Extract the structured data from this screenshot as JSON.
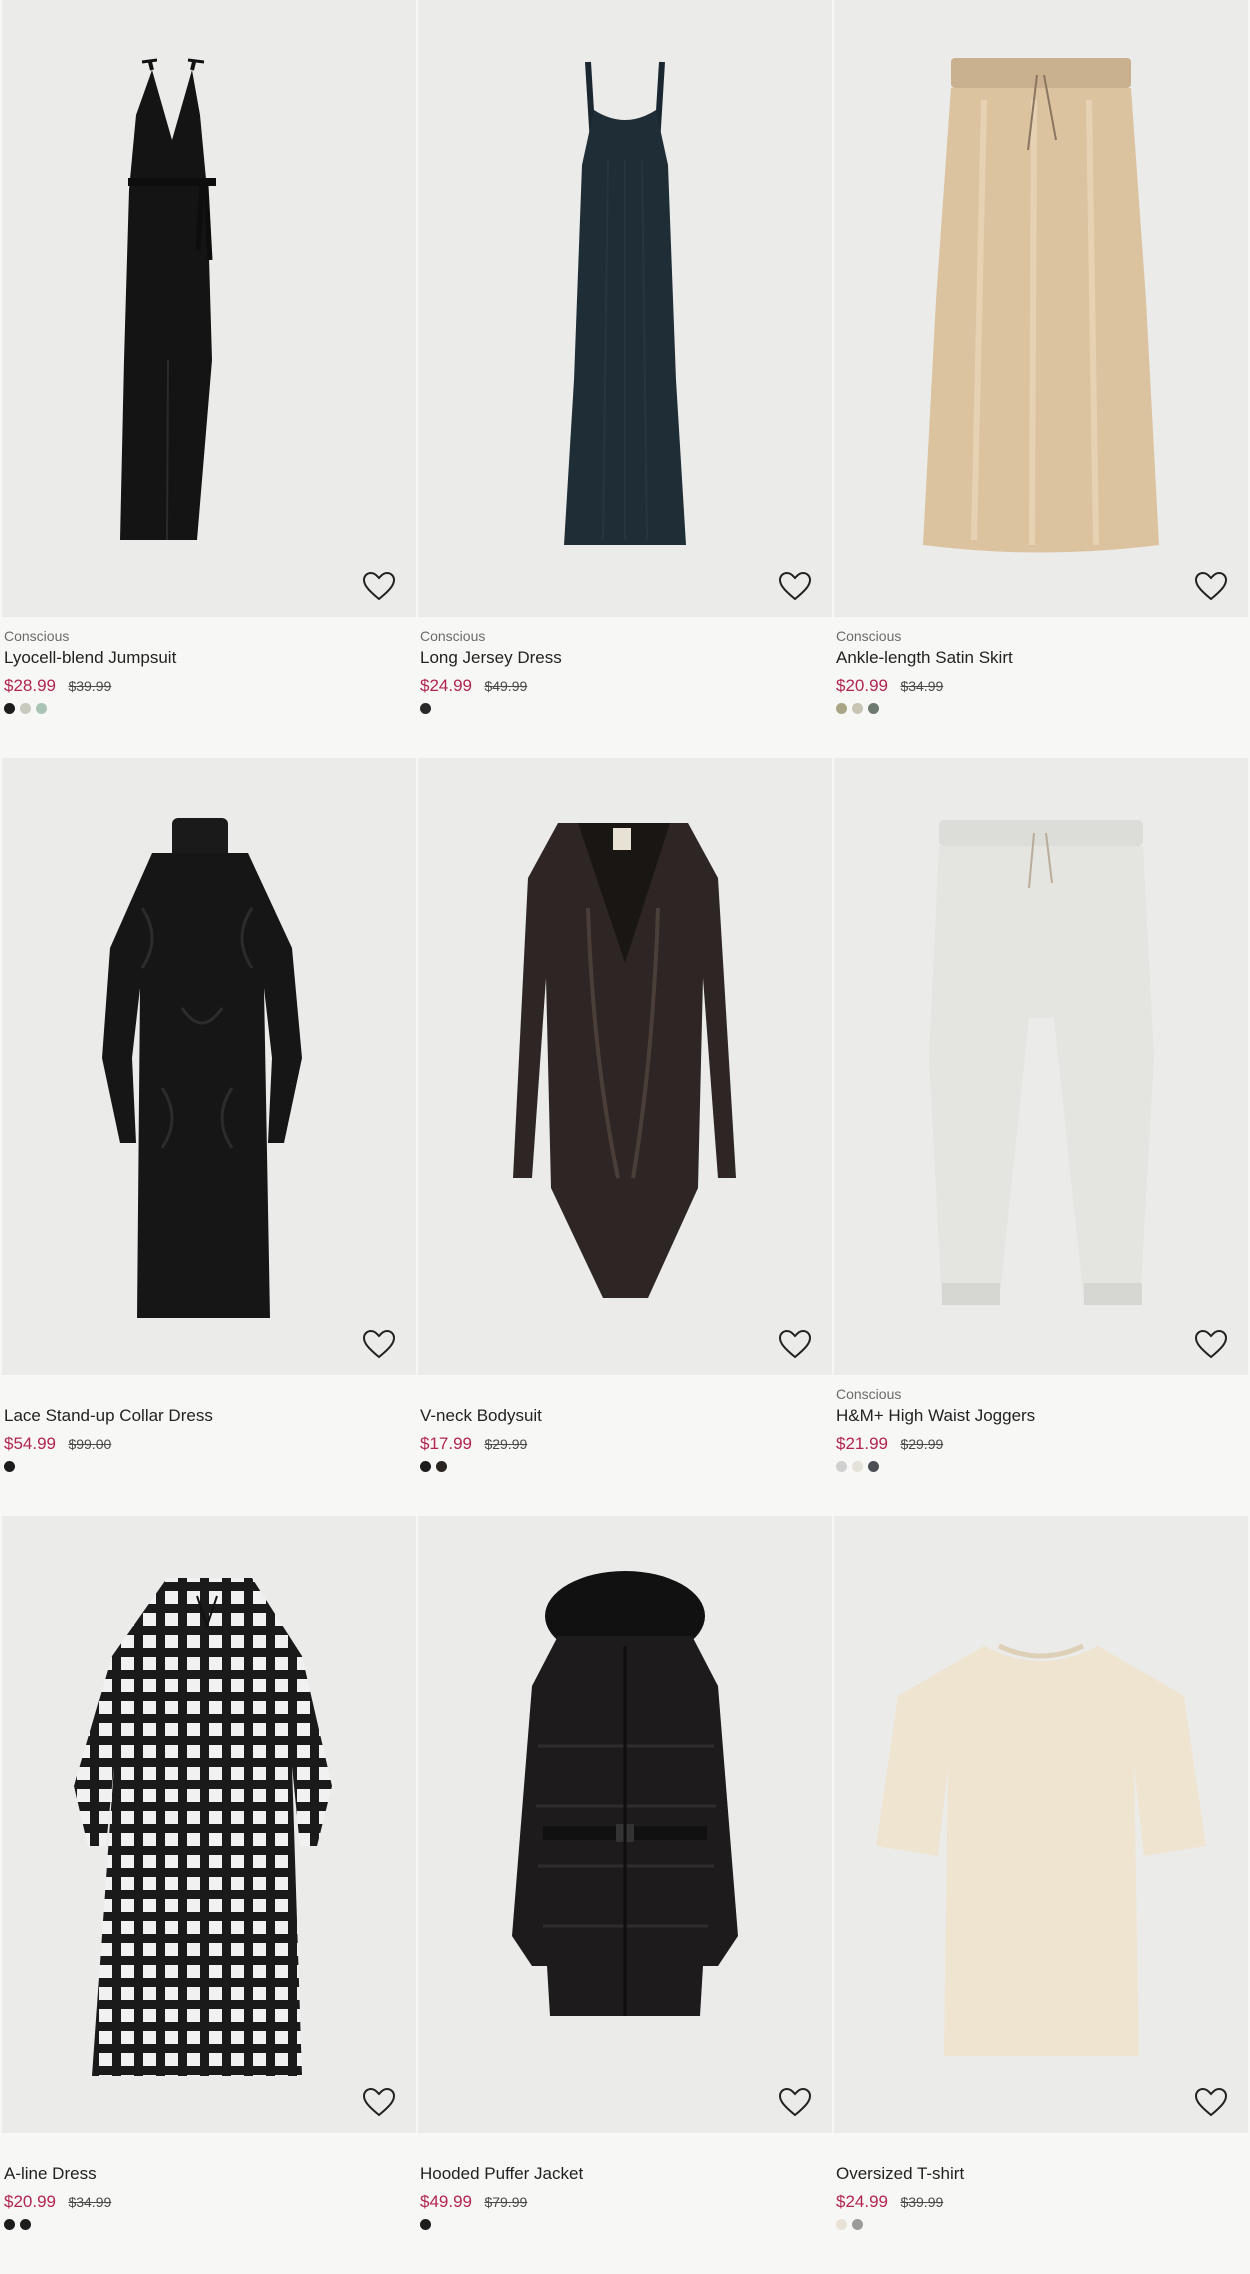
{
  "products": [
    {
      "tag": "Conscious",
      "name": "Lyocell-blend Jumpsuit",
      "price": "$28.99",
      "old_price": "$39.99",
      "swatches": [
        "#1c1c1c",
        "#c7c9bf",
        "#a9c4b4"
      ]
    },
    {
      "tag": "Conscious",
      "name": "Long Jersey Dress",
      "price": "$24.99",
      "old_price": "$49.99",
      "swatches": [
        "#2a2a2a"
      ]
    },
    {
      "tag": "Conscious",
      "name": "Ankle-length Satin Skirt",
      "price": "$20.99",
      "old_price": "$34.99",
      "swatches": [
        "#a8a486",
        "#c9c5b4",
        "#6e7a6f"
      ]
    },
    {
      "tag": "",
      "name": "Lace Stand-up Collar Dress",
      "price": "$54.99",
      "old_price": "$99.00",
      "swatches": [
        "#1c1c1c"
      ]
    },
    {
      "tag": "",
      "name": "V-neck Bodysuit",
      "price": "$17.99",
      "old_price": "$29.99",
      "swatches": [
        "#1c1c1c",
        "#2b2522"
      ]
    },
    {
      "tag": "Conscious",
      "name": "H&M+ High Waist Joggers",
      "price": "$21.99",
      "old_price": "$29.99",
      "swatches": [
        "#cfcfcf",
        "#e4e2d9",
        "#4b4f55"
      ]
    },
    {
      "tag": "",
      "name": "A-line Dress",
      "price": "$20.99",
      "old_price": "$34.99",
      "swatches": [
        "#1c1c1c",
        "#1c1c1c"
      ]
    },
    {
      "tag": "",
      "name": "Hooded Puffer Jacket",
      "price": "$49.99",
      "old_price": "$79.99",
      "swatches": [
        "#1c1c1c"
      ]
    },
    {
      "tag": "",
      "name": "Oversized T-shirt",
      "price": "$24.99",
      "old_price": "$39.99",
      "swatches": [
        "#e6e3d6",
        "#9a9c99"
      ]
    }
  ]
}
